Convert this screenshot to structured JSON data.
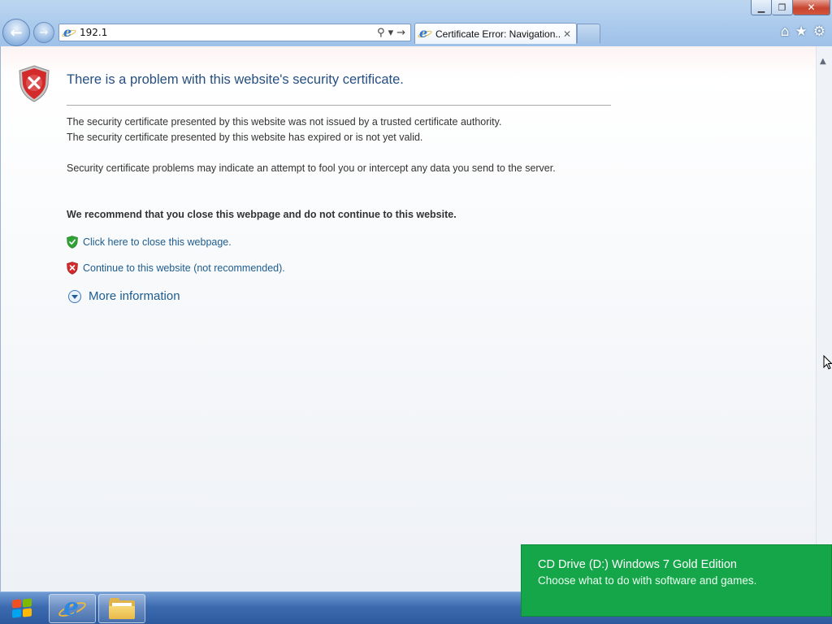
{
  "window": {
    "minimize_glyph": "▁",
    "restore_glyph": "❐",
    "close_glyph": "✕"
  },
  "navigation": {
    "back_glyph": "←",
    "forward_glyph": "→"
  },
  "address_bar": {
    "url": "192.1",
    "search_glyph": "⚲",
    "dropdown_glyph": "▾",
    "go_glyph": "→"
  },
  "tab": {
    "title": "Certificate Error: Navigation...",
    "close_glyph": "✕"
  },
  "command_icons": {
    "home_glyph": "⌂",
    "favorites_glyph": "★",
    "tools_glyph": "⚙"
  },
  "page": {
    "heading": "There is a problem with this website's security certificate.",
    "paragraph_1_line_1": "The security certificate presented by this website was not issued by a trusted certificate authority.",
    "paragraph_1_line_2": "The security certificate presented by this website has expired or is not yet valid.",
    "paragraph_2": "Security certificate problems may indicate an attempt to fool you or intercept any data you send to the server.",
    "recommendation": "We recommend that you close this webpage and do not continue to this website.",
    "close_link": "Click here to close this webpage.",
    "continue_link": "Continue to this website (not recommended).",
    "more_information": "More information"
  },
  "toast": {
    "title": "CD Drive (D:) Windows 7 Gold Edition",
    "subtitle": "Choose what to do with software and games."
  },
  "icons": {
    "error_shield": "shield-error-icon",
    "close_page_shield": "shield-check-icon",
    "continue_shield": "shield-x-icon",
    "more_info": "expand-circle-icon"
  },
  "colors": {
    "heading": "#264f80",
    "link": "#1d5c8f",
    "toast": "#15a64a",
    "error_red": "#d32b2b",
    "safe_green": "#2fa236"
  }
}
